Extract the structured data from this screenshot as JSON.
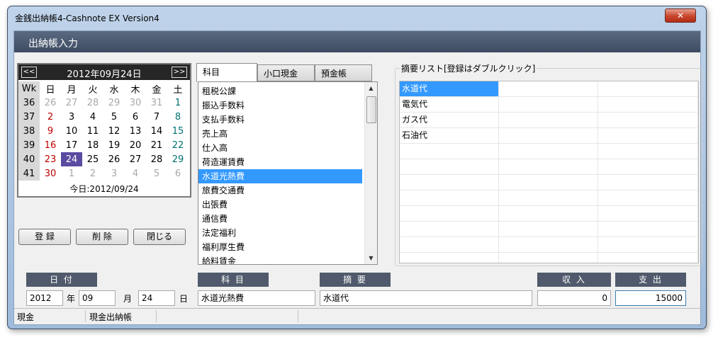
{
  "window": {
    "title": "金銭出納帳4-Cashnote EX Version4",
    "close_label": "✕"
  },
  "header": {
    "title": "出納帳入力"
  },
  "calendar": {
    "prev": "<<",
    "next": ">>",
    "month": "2012年09月24日",
    "headers": [
      "Wk",
      "日",
      "月",
      "火",
      "水",
      "木",
      "金",
      "土"
    ],
    "rows": [
      [
        "36",
        "26",
        "27",
        "28",
        "29",
        "30",
        "31",
        "1"
      ],
      [
        "37",
        "2",
        "3",
        "4",
        "5",
        "6",
        "7",
        "8"
      ],
      [
        "38",
        "9",
        "10",
        "11",
        "12",
        "13",
        "14",
        "15"
      ],
      [
        "39",
        "16",
        "17",
        "18",
        "19",
        "20",
        "21",
        "22"
      ],
      [
        "40",
        "23",
        "24",
        "25",
        "26",
        "27",
        "28",
        "29"
      ],
      [
        "41",
        "30",
        "1",
        "2",
        "3",
        "4",
        "5",
        "6"
      ]
    ],
    "today": "今日:2012/09/24"
  },
  "buttons": {
    "register": "登 録",
    "delete": "削 除",
    "close": "閉じる"
  },
  "tabs": [
    "科目",
    "小口現金",
    "預金帳"
  ],
  "account_list": [
    "租税公課",
    "振込手数料",
    "支払手数料",
    "売上高",
    "仕入高",
    "荷造運賃費",
    "水道光熱費",
    "旅費交通費",
    "出張費",
    "通信費",
    "法定福利",
    "福利厚生費",
    "給料賃金"
  ],
  "summary": {
    "label": "摘要リスト[登録はダブルクリック]",
    "items": [
      "水道代",
      "電気代",
      "ガス代",
      "石油代"
    ]
  },
  "form": {
    "date_label": "日 付",
    "account_label": "科 目",
    "summary_label": "摘 要",
    "income_label": "収 入",
    "expense_label": "支 出",
    "year": "2012",
    "year_unit": "年",
    "month": "09",
    "month_unit": "月",
    "day": "24",
    "day_unit": "日",
    "account": "水道光熱費",
    "summary": "水道代",
    "income": "0",
    "expense": "15000"
  },
  "status": {
    "panel1": "現金",
    "panel2": "現金出納帳"
  },
  "colors": {
    "header": "#3d4c61",
    "selection": "#3399ff",
    "today": "#5a4aa0",
    "sunday": "#c00000",
    "saturday": "#007070"
  }
}
